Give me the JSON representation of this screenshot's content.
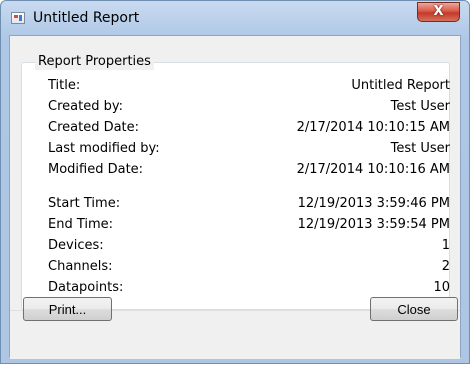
{
  "window": {
    "title": "Untitled Report",
    "close_glyph": "X"
  },
  "group": {
    "label": "Report Properties"
  },
  "properties": [
    {
      "label": "Title:",
      "value": "Untitled Report"
    },
    {
      "label": "Created by:",
      "value": "Test User"
    },
    {
      "label": "Created Date:",
      "value": "2/17/2014 10:10:15 AM"
    },
    {
      "label": "Last modified by:",
      "value": "Test User"
    },
    {
      "label": "Modified Date:",
      "value": "2/17/2014 10:10:16 AM"
    },
    {
      "label": "Start Time:",
      "value": "12/19/2013 3:59:46 PM"
    },
    {
      "label": "End Time:",
      "value": "12/19/2013 3:59:54 PM"
    },
    {
      "label": "Devices:",
      "value": "1"
    },
    {
      "label": "Channels:",
      "value": "2"
    },
    {
      "label": "Datapoints:",
      "value": "10"
    }
  ],
  "buttons": {
    "print": "Print...",
    "close": "Close"
  },
  "colors": {
    "titlebar": "#b6cde9",
    "close_button": "#c43a29",
    "client_bg": "#f0f0f0"
  },
  "icons": {
    "app": "report-icon",
    "close": "close-icon"
  }
}
